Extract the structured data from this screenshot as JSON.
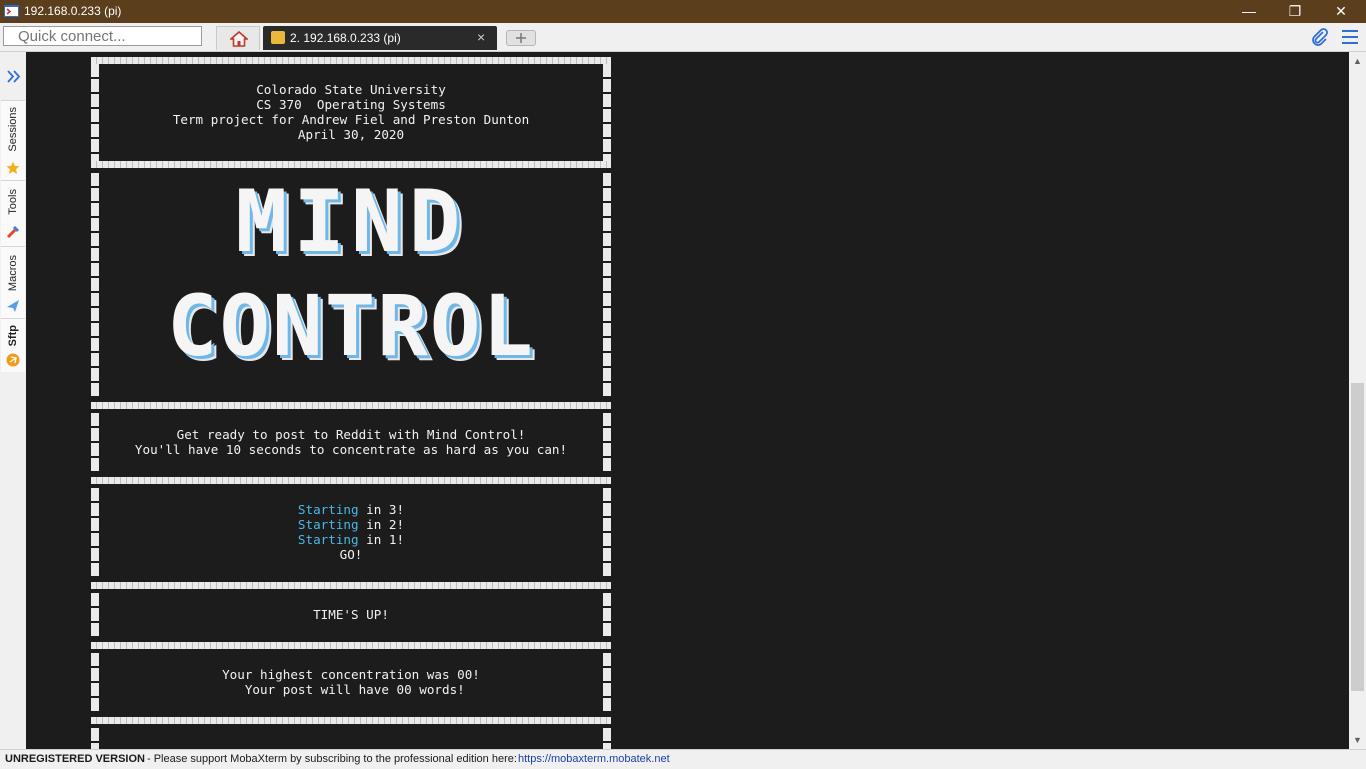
{
  "window": {
    "title": "192.168.0.233 (pi)",
    "controls": {
      "minimize": "—",
      "restore": "❐",
      "close": "✕"
    }
  },
  "toolbar": {
    "quick_connect_placeholder": "Quick connect...",
    "home_icon": "home-icon",
    "tab_label": "2. 192.168.0.233 (pi)",
    "tab_close": "×",
    "new_tab_icon": "new-tab-icon",
    "attach_icon": "paperclip-icon",
    "menu_icon": "hamburger-icon"
  },
  "sidebar": {
    "tabs": [
      {
        "label": "Sessions",
        "icon": "star-icon"
      },
      {
        "label": "Tools",
        "icon": "tools-icon"
      },
      {
        "label": "Macros",
        "icon": "paper-plane-icon"
      },
      {
        "label": "Sftp",
        "icon": "sftp-icon"
      }
    ]
  },
  "terminal": {
    "header_lines": [
      "Colorado State University",
      "CS 370  Operating Systems",
      "Term project for Andrew Fiel and Preston Dunton",
      "April 30, 2020"
    ],
    "art_line1": "MIND",
    "art_line2": "CONTROL",
    "intro_lines": [
      "Get ready to post to Reddit with Mind Control!",
      "You'll have 10 seconds to concentrate as hard as you can!"
    ],
    "countdown": [
      {
        "word": "Starting",
        "rest": " in 3!"
      },
      {
        "word": "Starting",
        "rest": " in 2!"
      },
      {
        "word": "Starting",
        "rest": " in 1!"
      }
    ],
    "go": "GO!",
    "times_up": "TIME'S UP!",
    "result_lines": [
      "Your highest concentration was 00!",
      " Your post will have 00 words!"
    ]
  },
  "status_bar": {
    "edition": "UNREGISTERED VERSION",
    "message": "-  Please support MobaXterm by subscribing to the professional edition here:",
    "link": "https://mobaxterm.mobatek.net"
  },
  "colors": {
    "title_bar": "#5b3f1d",
    "terminal_bg": "#1c1c1c",
    "terminal_fg": "#f2f2f2",
    "accent_cyan": "#49b8e6",
    "tab_bg": "#2a2a2a"
  }
}
